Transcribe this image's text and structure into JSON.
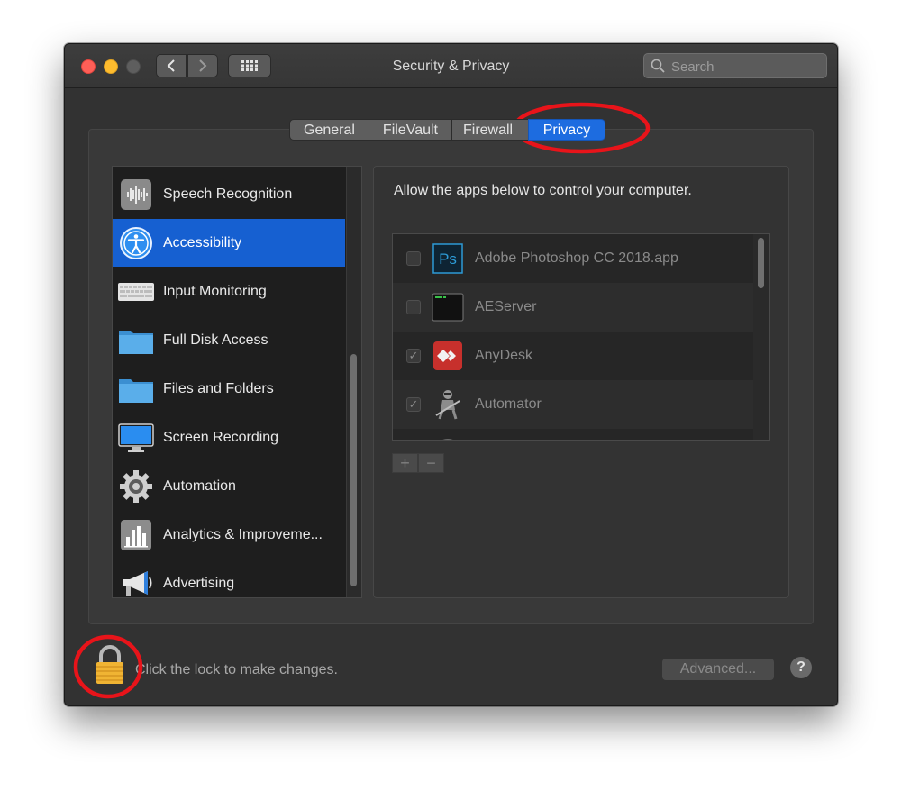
{
  "window": {
    "title": "Security & Privacy"
  },
  "search": {
    "placeholder": "Search"
  },
  "tabs": [
    {
      "label": "General"
    },
    {
      "label": "FileVault"
    },
    {
      "label": "Firewall"
    },
    {
      "label": "Privacy",
      "selected": true
    }
  ],
  "sidebar": {
    "items": [
      {
        "label": "Speech Recognition",
        "icon": "waveform-icon"
      },
      {
        "label": "Accessibility",
        "icon": "accessibility-icon",
        "selected": true
      },
      {
        "label": "Input Monitoring",
        "icon": "keyboard-icon"
      },
      {
        "label": "Full Disk Access",
        "icon": "folder-icon"
      },
      {
        "label": "Files and Folders",
        "icon": "folder-icon"
      },
      {
        "label": "Screen Recording",
        "icon": "display-icon"
      },
      {
        "label": "Automation",
        "icon": "gear-icon"
      },
      {
        "label": "Analytics & Improveme...",
        "icon": "bar-chart-icon"
      },
      {
        "label": "Advertising",
        "icon": "megaphone-icon"
      }
    ]
  },
  "content": {
    "description": "Allow the apps below to control your computer.",
    "apps": [
      {
        "name": "Adobe Photoshop CC 2018.app",
        "checked": false,
        "icon": "photoshop-icon"
      },
      {
        "name": "AEServer",
        "checked": false,
        "icon": "terminal-icon"
      },
      {
        "name": "AnyDesk",
        "checked": true,
        "icon": "anydesk-icon"
      },
      {
        "name": "Automator",
        "checked": true,
        "icon": "automator-icon"
      }
    ],
    "add_label": "+",
    "remove_label": "−",
    "check_mark": "✓",
    "photoshop_icon_text": "Ps"
  },
  "footer": {
    "lock_text": "Click the lock to make changes.",
    "advanced_label": "Advanced...",
    "help_label": "?"
  },
  "colors": {
    "accent": "#1660d1",
    "annotation": "#e8141a",
    "window_bg": "#323232"
  }
}
